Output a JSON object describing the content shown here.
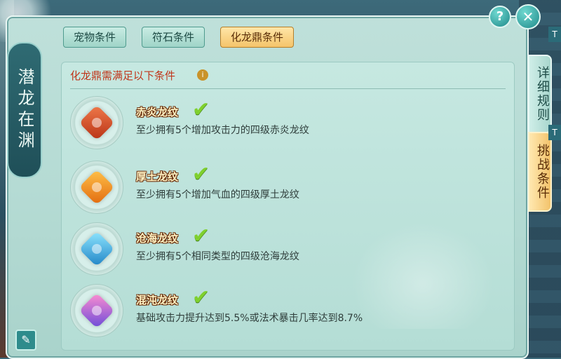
{
  "side_title": "潜龙在渊",
  "tabs": [
    {
      "label": "宠物条件",
      "active": false
    },
    {
      "label": "符石条件",
      "active": false
    },
    {
      "label": "化龙鼎条件",
      "active": true
    }
  ],
  "right_tabs": [
    {
      "label": "详细规则",
      "active": false
    },
    {
      "label": "挑战条件",
      "active": true
    }
  ],
  "header": {
    "help_icon": "?",
    "close_icon": "✕"
  },
  "conditions": {
    "title": "化龙鼎需满足以下条件",
    "items": [
      {
        "name": "赤炎龙纹",
        "desc": "至少拥有5个增加攻击力的四级赤炎龙纹",
        "met": true,
        "color": "#d9532a"
      },
      {
        "name": "厚土龙纹",
        "desc": "至少拥有5个增加气血的四级厚土龙纹",
        "met": true,
        "color": "#f08a1c"
      },
      {
        "name": "沧海龙纹",
        "desc": "至少拥有5个相同类型的四级沧海龙纹",
        "met": true,
        "color": "#2fa6d6"
      },
      {
        "name": "混沌龙纹",
        "desc": "基础攻击力提升达到5.5%或法术暴击几率达到8.7%",
        "met": true,
        "color": "#a06ad8"
      }
    ]
  },
  "colors": {
    "accent": "#c0361b",
    "check": "#7fd02e"
  }
}
